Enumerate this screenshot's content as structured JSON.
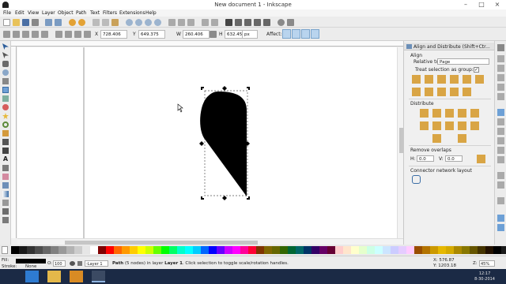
{
  "window": {
    "title": "New document 1 - Inkscape",
    "minimize": "–",
    "maximize": "□",
    "close": "×"
  },
  "menu": [
    "File",
    "Edit",
    "View",
    "Layer",
    "Object",
    "Path",
    "Text",
    "Filters",
    "Extensions",
    "Help"
  ],
  "tool_controls": {
    "x_label": "X",
    "x_value": "728.406",
    "y_label": "Y",
    "y_value": "649.375",
    "w_label": "W",
    "w_value": "260.406",
    "h_label": "H",
    "h_value": "632.455",
    "unit": "px",
    "affect_label": "Affect:"
  },
  "panel": {
    "title": "Align and Distribute (Shift+Ctr...",
    "align_section": "Align",
    "relative_to_label": "Relative to:",
    "relative_to_value": "Page",
    "treat_group_label": "Treat selection as group:",
    "treat_group_checked": "✓",
    "distribute_section": "Distribute",
    "remove_overlaps_section": "Remove overlaps",
    "h_label": "H:",
    "h_value": "0.0",
    "v_label": "V:",
    "v_value": "0.0",
    "connector_section": "Connector network layout"
  },
  "status": {
    "fill_label": "Fill:",
    "stroke_label": "Stroke:",
    "stroke_value": "None",
    "opacity_label": "O:",
    "opacity_value": "100",
    "layer_value": "-Layer 1",
    "message_bold": "Path",
    "message_rest": " (5 nodes) in layer ",
    "message_layer": "Layer 1",
    "message_tail": ". Click selection to toggle scale/rotation handles.",
    "cursor_x": "X: 576.87",
    "cursor_y": "Y: 1203.18",
    "zoom_label": "Z:",
    "zoom_value": "45%"
  },
  "taskbar": {
    "time": "12:17",
    "date": "8-30-2014"
  },
  "colors": {
    "accent": "#3a79c4",
    "canvas": "#ffffff",
    "shape_fill": "#000000"
  },
  "icons": [
    "selector-icon",
    "node-icon",
    "zoom-icon",
    "rect-icon",
    "ellipse-icon",
    "star-icon",
    "spiral-icon",
    "pencil-icon",
    "pen-icon",
    "text-icon",
    "gradient-icon",
    "dropper-icon"
  ]
}
